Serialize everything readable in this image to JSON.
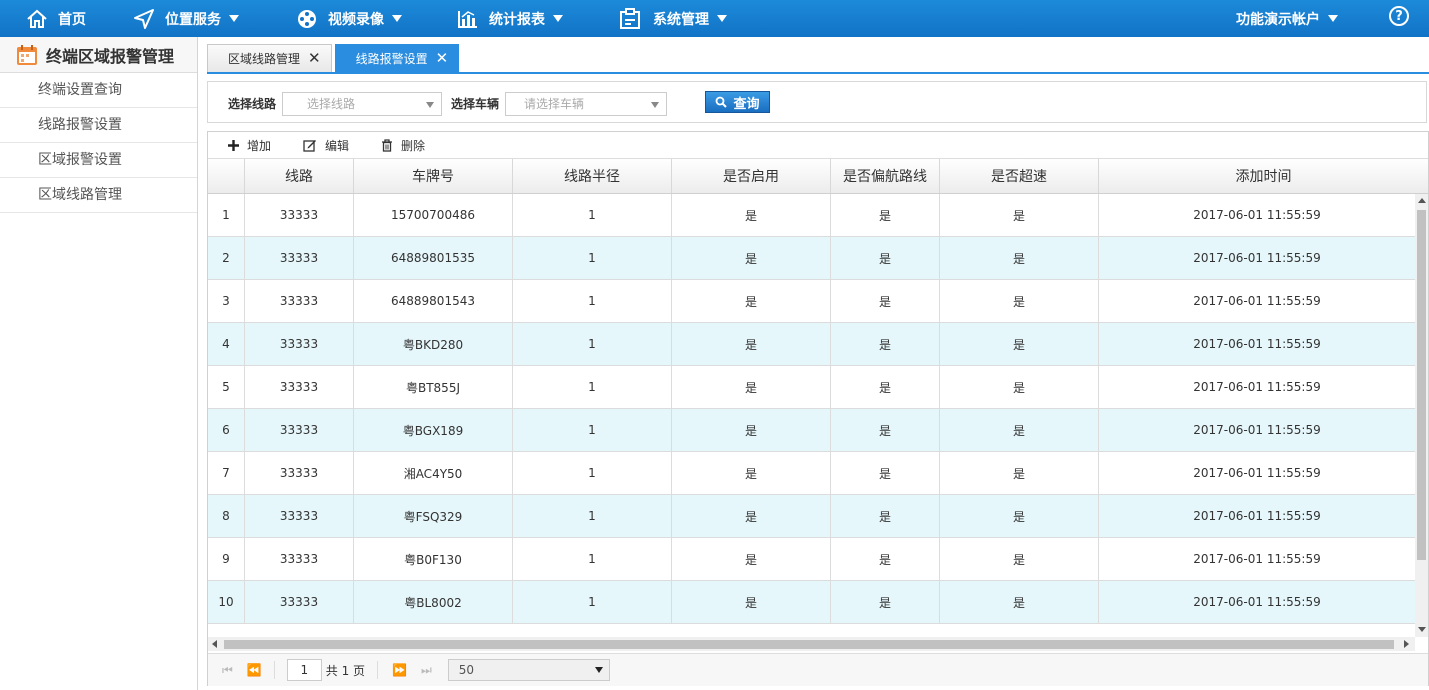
{
  "nav": {
    "items": [
      {
        "label": "首页",
        "icon": "home-icon",
        "dropdown": false
      },
      {
        "label": "位置服务",
        "icon": "location-arrow-icon",
        "dropdown": true
      },
      {
        "label": "视频录像",
        "icon": "film-reel-icon",
        "dropdown": true
      },
      {
        "label": "统计报表",
        "icon": "bar-chart-icon",
        "dropdown": true
      },
      {
        "label": "系统管理",
        "icon": "system-settings-icon",
        "dropdown": true
      }
    ],
    "account_label": "功能演示帐户",
    "help_label": "?"
  },
  "sidebar": {
    "title": "终端区域报警管理",
    "items": [
      {
        "label": "终端设置查询"
      },
      {
        "label": "线路报警设置"
      },
      {
        "label": "区域报警设置"
      },
      {
        "label": "区域线路管理"
      }
    ]
  },
  "tabs": [
    {
      "label": "区域线路管理",
      "active": false
    },
    {
      "label": "线路报警设置",
      "active": true
    }
  ],
  "filter": {
    "route_label": "选择线路",
    "route_placeholder": "选择线路",
    "vehicle_label": "选择车辆",
    "vehicle_placeholder": "请选择车辆",
    "query_label": "查询"
  },
  "toolbar": {
    "add_label": "增加",
    "edit_label": "编辑",
    "delete_label": "删除"
  },
  "table": {
    "columns": [
      "线路",
      "车牌号",
      "线路半径",
      "是否启用",
      "是否偏航路线",
      "是否超速",
      "添加时间"
    ],
    "rows": [
      {
        "n": "1",
        "route": "33333",
        "plate": "15700700486",
        "radius": "1",
        "enabled": "是",
        "deviation": "是",
        "overspeed": "是",
        "time": "2017-06-01 11:55:59"
      },
      {
        "n": "2",
        "route": "33333",
        "plate": "64889801535",
        "radius": "1",
        "enabled": "是",
        "deviation": "是",
        "overspeed": "是",
        "time": "2017-06-01 11:55:59"
      },
      {
        "n": "3",
        "route": "33333",
        "plate": "64889801543",
        "radius": "1",
        "enabled": "是",
        "deviation": "是",
        "overspeed": "是",
        "time": "2017-06-01 11:55:59"
      },
      {
        "n": "4",
        "route": "33333",
        "plate": "粤BKD280",
        "radius": "1",
        "enabled": "是",
        "deviation": "是",
        "overspeed": "是",
        "time": "2017-06-01 11:55:59"
      },
      {
        "n": "5",
        "route": "33333",
        "plate": "粤BT855J",
        "radius": "1",
        "enabled": "是",
        "deviation": "是",
        "overspeed": "是",
        "time": "2017-06-01 11:55:59"
      },
      {
        "n": "6",
        "route": "33333",
        "plate": "粤BGX189",
        "radius": "1",
        "enabled": "是",
        "deviation": "是",
        "overspeed": "是",
        "time": "2017-06-01 11:55:59"
      },
      {
        "n": "7",
        "route": "33333",
        "plate": "湘AC4Y50",
        "radius": "1",
        "enabled": "是",
        "deviation": "是",
        "overspeed": "是",
        "time": "2017-06-01 11:55:59"
      },
      {
        "n": "8",
        "route": "33333",
        "plate": "粤FSQ329",
        "radius": "1",
        "enabled": "是",
        "deviation": "是",
        "overspeed": "是",
        "time": "2017-06-01 11:55:59"
      },
      {
        "n": "9",
        "route": "33333",
        "plate": "粤B0F130",
        "radius": "1",
        "enabled": "是",
        "deviation": "是",
        "overspeed": "是",
        "time": "2017-06-01 11:55:59"
      },
      {
        "n": "10",
        "route": "33333",
        "plate": "粤BL8002",
        "radius": "1",
        "enabled": "是",
        "deviation": "是",
        "overspeed": "是",
        "time": "2017-06-01 11:55:59"
      }
    ]
  },
  "pager": {
    "page": "1",
    "total_label": "共 1 页",
    "page_size": "50"
  },
  "colors": {
    "nav_bg": "#1273c6",
    "accent": "#2b8de0",
    "row_alt": "#e6f7fc"
  }
}
